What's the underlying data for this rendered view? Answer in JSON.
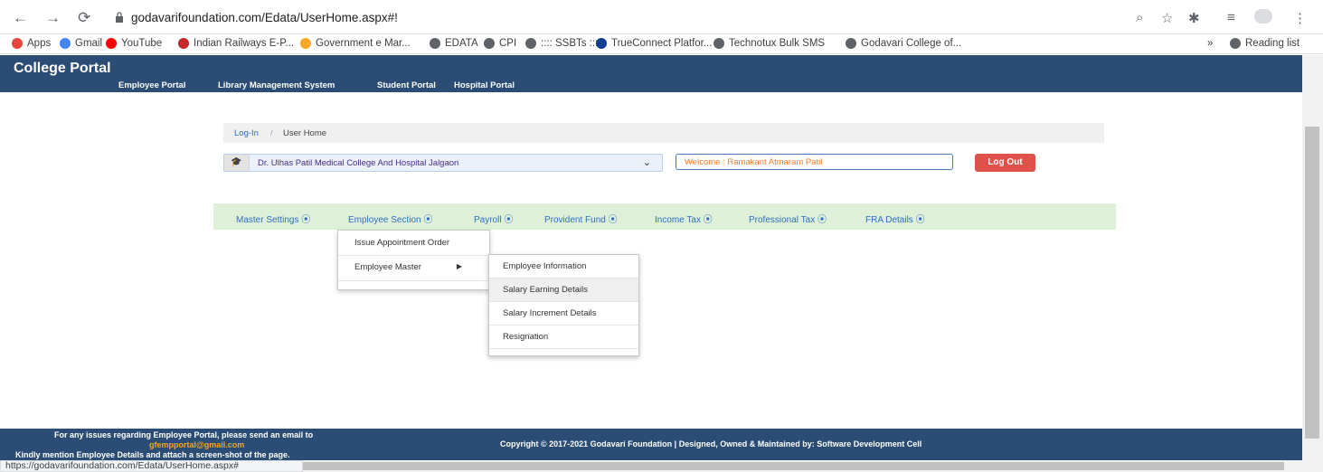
{
  "browser": {
    "url": "godavarifoundation.com/Edata/UserHome.aspx#!",
    "bookmarks": [
      {
        "label": "Apps",
        "icon": "apps-icon",
        "color": "#e8453c"
      },
      {
        "label": "Gmail",
        "icon": "google-icon",
        "color": "#4285f4"
      },
      {
        "label": "YouTube",
        "icon": "youtube-icon",
        "color": "#ff0000"
      },
      {
        "label": "Indian Railways E-P...",
        "icon": "railways-icon",
        "color": "#c62828"
      },
      {
        "label": "Government e Mar...",
        "icon": "gem-icon",
        "color": "#f9a825"
      },
      {
        "label": "EDATA",
        "icon": "globe-icon",
        "color": "#5f6368"
      },
      {
        "label": "CPI",
        "icon": "globe-icon",
        "color": "#5f6368"
      },
      {
        "label": ":::: SSBTs ::::",
        "icon": "globe-icon",
        "color": "#5f6368"
      },
      {
        "label": "TrueConnect Platfor...",
        "icon": "jio-icon",
        "color": "#0a3d91"
      },
      {
        "label": "Technotux Bulk SMS",
        "icon": "globe-icon",
        "color": "#5f6368"
      },
      {
        "label": "Godavari College of...",
        "icon": "globe-icon",
        "color": "#5f6368"
      },
      {
        "label": "Reading list",
        "icon": "reading-list-icon",
        "color": "#5f6368"
      }
    ],
    "more_bookmarks": "»",
    "status_url": "https://godavarifoundation.com/Edata/UserHome.aspx#"
  },
  "site": {
    "brand": "College Portal",
    "topnav": [
      "Employee Portal",
      "Library Management System",
      "Student Portal",
      "Hospital Portal"
    ],
    "breadcrumb": {
      "link": "Log-In",
      "separator": "/",
      "current": "User Home"
    },
    "college_select": {
      "value": "Dr. Ulhas Patil Medical College And Hospital Jalgaon"
    },
    "welcome": "Welcome : Ramakant Atmaram Patil",
    "logout": "Log Out",
    "menu": [
      "Master Settings",
      "Employee Section",
      "Payroll",
      "Provident Fund",
      "Income Tax",
      "Professional Tax",
      "FRA Details"
    ],
    "dropdown": {
      "items": [
        "Issue Appointment Order",
        "Employee Master"
      ],
      "submenu": [
        "Employee Information",
        "Salary Earning Details",
        "Salary Increment Details",
        "Resignation"
      ]
    },
    "footer": {
      "line1": "For any issues regarding Employee Portal, please send an email to",
      "email": "gfempportal@gmail.com",
      "line3": "Kindly mention Employee Details and attach a screen-shot of the page.",
      "copyright": "Copyright © 2017-2021 Godavari Foundation | Designed, Owned & Maintained by: Software Development Cell"
    }
  },
  "colors": {
    "header": "#2b4c74",
    "menubar": "#dff0d8",
    "logout": "#e05149",
    "welcome_text": "#f07c2a",
    "email": "#f5a623"
  }
}
